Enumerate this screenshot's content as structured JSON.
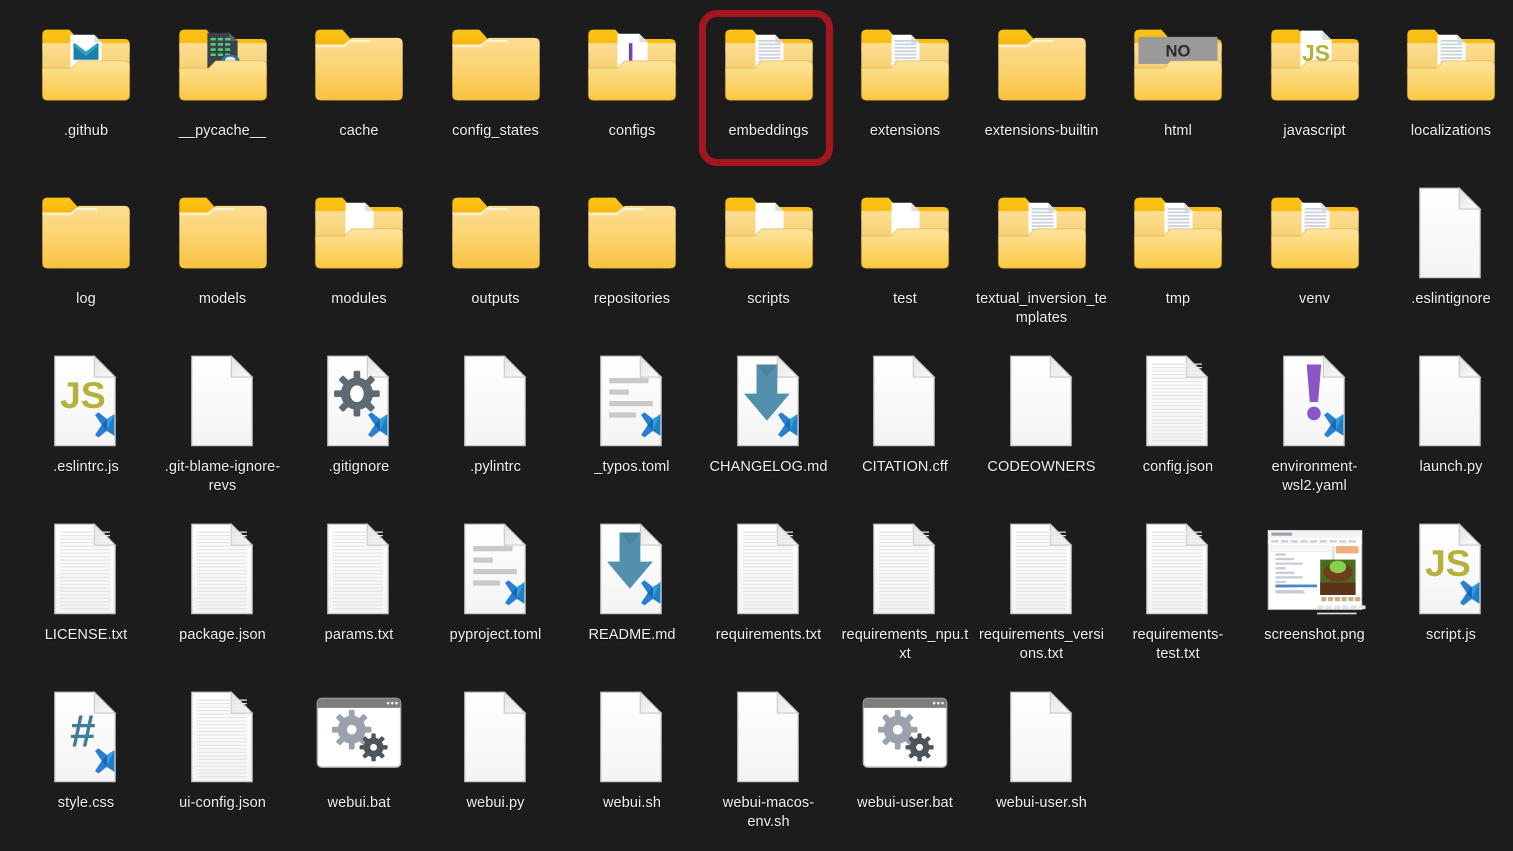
{
  "view": {
    "background_color": "#1c1c1c",
    "label_color": "#f0f0f0",
    "columns": 11,
    "rows": 5,
    "highlight_color": "#a4161f",
    "highlighted_item": "embeddings"
  },
  "items": [
    {
      "name": ".github",
      "type": "folder",
      "icon": "folder-github-icon",
      "row": 0,
      "col": 0
    },
    {
      "name": "__pycache__",
      "type": "folder",
      "icon": "folder-code-icon",
      "row": 0,
      "col": 1
    },
    {
      "name": "cache",
      "type": "folder",
      "icon": "folder-empty-icon",
      "row": 0,
      "col": 2
    },
    {
      "name": "config_states",
      "type": "folder",
      "icon": "folder-empty-icon",
      "row": 0,
      "col": 3
    },
    {
      "name": "configs",
      "type": "folder",
      "icon": "folder-doc-purple-icon",
      "row": 0,
      "col": 4
    },
    {
      "name": "embeddings",
      "type": "folder",
      "icon": "folder-lined-doc-icon",
      "row": 0,
      "col": 5,
      "selected": true
    },
    {
      "name": "extensions",
      "type": "folder",
      "icon": "folder-lined-doc-icon",
      "row": 0,
      "col": 6
    },
    {
      "name": "extensions-builtin",
      "type": "folder",
      "icon": "folder-empty-icon",
      "row": 0,
      "col": 7
    },
    {
      "name": "html",
      "type": "folder",
      "icon": "folder-no-banner-icon",
      "row": 0,
      "col": 8
    },
    {
      "name": "javascript",
      "type": "folder",
      "icon": "folder-js-icon",
      "row": 0,
      "col": 9
    },
    {
      "name": "localizations",
      "type": "folder",
      "icon": "folder-lined-doc-icon",
      "row": 0,
      "col": 10
    },
    {
      "name": "log",
      "type": "folder",
      "icon": "folder-empty-icon",
      "row": 1,
      "col": 0
    },
    {
      "name": "models",
      "type": "folder",
      "icon": "folder-empty-icon",
      "row": 1,
      "col": 1
    },
    {
      "name": "modules",
      "type": "folder",
      "icon": "folder-blank-doc-icon",
      "row": 1,
      "col": 2
    },
    {
      "name": "outputs",
      "type": "folder",
      "icon": "folder-empty-icon",
      "row": 1,
      "col": 3
    },
    {
      "name": "repositories",
      "type": "folder",
      "icon": "folder-empty-icon",
      "row": 1,
      "col": 4
    },
    {
      "name": "scripts",
      "type": "folder",
      "icon": "folder-blank-doc-icon",
      "row": 1,
      "col": 5
    },
    {
      "name": "test",
      "type": "folder",
      "icon": "folder-blank-doc-icon",
      "row": 1,
      "col": 6
    },
    {
      "name": "textual_inversion_templates",
      "type": "folder",
      "icon": "folder-lined-doc-icon",
      "row": 1,
      "col": 7
    },
    {
      "name": "tmp",
      "type": "folder",
      "icon": "folder-lined-doc-icon",
      "row": 1,
      "col": 8
    },
    {
      "name": "venv",
      "type": "folder",
      "icon": "folder-lined-doc-icon",
      "row": 1,
      "col": 9
    },
    {
      "name": ".eslintignore",
      "type": "file",
      "icon": "file-blank-icon",
      "row": 1,
      "col": 10
    },
    {
      "name": ".eslintrc.js",
      "type": "file",
      "icon": "file-js-vscode-icon",
      "row": 2,
      "col": 0
    },
    {
      "name": ".git-blame-ignore-revs",
      "type": "file",
      "icon": "file-blank-icon",
      "row": 2,
      "col": 1
    },
    {
      "name": ".gitignore",
      "type": "file",
      "icon": "file-gear-vscode-icon",
      "row": 2,
      "col": 2
    },
    {
      "name": ".pylintrc",
      "type": "file",
      "icon": "file-blank-icon",
      "row": 2,
      "col": 3
    },
    {
      "name": "_typos.toml",
      "type": "file",
      "icon": "file-toml-vscode-icon",
      "row": 2,
      "col": 4
    },
    {
      "name": "CHANGELOG.md",
      "type": "file",
      "icon": "file-markdown-vscode-icon",
      "row": 2,
      "col": 5
    },
    {
      "name": "CITATION.cff",
      "type": "file",
      "icon": "file-blank-icon",
      "row": 2,
      "col": 6
    },
    {
      "name": "CODEOWNERS",
      "type": "file",
      "icon": "file-blank-icon",
      "row": 2,
      "col": 7
    },
    {
      "name": "config.json",
      "type": "file",
      "icon": "file-lined-icon",
      "row": 2,
      "col": 8
    },
    {
      "name": "environment-wsl2.yaml",
      "type": "file",
      "icon": "file-yaml-vscode-icon",
      "row": 2,
      "col": 9
    },
    {
      "name": "launch.py",
      "type": "file",
      "icon": "file-blank-icon",
      "row": 2,
      "col": 10
    },
    {
      "name": "LICENSE.txt",
      "type": "file",
      "icon": "file-lined-icon",
      "row": 3,
      "col": 0
    },
    {
      "name": "package.json",
      "type": "file",
      "icon": "file-lined-icon",
      "row": 3,
      "col": 1
    },
    {
      "name": "params.txt",
      "type": "file",
      "icon": "file-lined-icon",
      "row": 3,
      "col": 2
    },
    {
      "name": "pyproject.toml",
      "type": "file",
      "icon": "file-toml-vscode-icon",
      "row": 3,
      "col": 3
    },
    {
      "name": "README.md",
      "type": "file",
      "icon": "file-markdown-vscode-icon",
      "row": 3,
      "col": 4
    },
    {
      "name": "requirements.txt",
      "type": "file",
      "icon": "file-lined-icon",
      "row": 3,
      "col": 5
    },
    {
      "name": "requirements_npu.txt",
      "type": "file",
      "icon": "file-lined-icon",
      "row": 3,
      "col": 6
    },
    {
      "name": "requirements_versions.txt",
      "type": "file",
      "icon": "file-lined-icon",
      "row": 3,
      "col": 7
    },
    {
      "name": "requirements-test.txt",
      "type": "file",
      "icon": "file-lined-icon",
      "row": 3,
      "col": 8
    },
    {
      "name": "screenshot.png",
      "type": "file",
      "icon": "file-image-thumbnail-icon",
      "row": 3,
      "col": 9
    },
    {
      "name": "script.js",
      "type": "file",
      "icon": "file-js-vscode-icon",
      "row": 3,
      "col": 10
    },
    {
      "name": "style.css",
      "type": "file",
      "icon": "file-css-vscode-icon",
      "row": 4,
      "col": 0
    },
    {
      "name": "ui-config.json",
      "type": "file",
      "icon": "file-lined-icon",
      "row": 4,
      "col": 1
    },
    {
      "name": "webui.bat",
      "type": "file",
      "icon": "file-batch-gears-icon",
      "row": 4,
      "col": 2
    },
    {
      "name": "webui.py",
      "type": "file",
      "icon": "file-blank-icon",
      "row": 4,
      "col": 3
    },
    {
      "name": "webui.sh",
      "type": "file",
      "icon": "file-blank-icon",
      "row": 4,
      "col": 4
    },
    {
      "name": "webui-macos-env.sh",
      "type": "file",
      "icon": "file-blank-icon",
      "row": 4,
      "col": 5
    },
    {
      "name": "webui-user.bat",
      "type": "file",
      "icon": "file-batch-gears-icon",
      "row": 4,
      "col": 6
    },
    {
      "name": "webui-user.sh",
      "type": "file",
      "icon": "file-blank-icon",
      "row": 4,
      "col": 7
    }
  ]
}
